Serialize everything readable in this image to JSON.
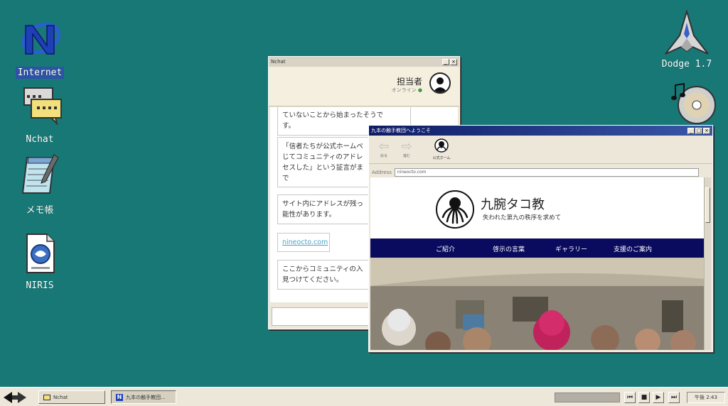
{
  "desktop": {
    "left_icons": [
      {
        "label": "Internet",
        "icon": "n-logo-icon",
        "selected": true
      },
      {
        "label": "Nchat",
        "icon": "chat-bubbles-icon"
      },
      {
        "label": "メモ帳",
        "icon": "notepad-icon"
      },
      {
        "label": "NIRIS",
        "icon": "document-icon"
      }
    ],
    "right_icons": [
      {
        "label": "Dodge 1.7",
        "icon": "spaceship-icon"
      },
      {
        "label": "",
        "icon": "music-cd-icon"
      }
    ]
  },
  "nchat": {
    "title": "Nchat",
    "agent_name": "担当者",
    "agent_status": "オンライン",
    "messages": [
      {
        "lines": [
          "ていないことから始まったそうで",
          "す。"
        ]
      },
      {
        "lines": [
          "「信者たちが公式ホームペ",
          "じてコミュニティのアドレ",
          "セスした」という証言がま",
          "で"
        ]
      },
      {
        "lines": [
          "サイト内にアドレスが残っ",
          "能性があります。"
        ]
      },
      {
        "lines": [
          "nineocto.com"
        ],
        "is_link": true
      },
      {
        "lines": [
          "ここからコミュニティの入",
          "見つけてください。"
        ]
      }
    ]
  },
  "browser": {
    "title": "九本の触手教団へようこそ",
    "toolbar": {
      "back": "戻る",
      "forward": "進む",
      "home": "公式ホーム"
    },
    "address_label": "Address",
    "address": "nineocto.com",
    "site": {
      "title": "九腕タコ教",
      "subtitle": "失われた第九の秩序を求めて",
      "nav": [
        "ご紹介",
        "啓示の言葉",
        "ギャラリー",
        "支援のご案内"
      ]
    }
  },
  "taskbar": {
    "buttons": [
      {
        "label": "Nchat"
      },
      {
        "label": "九本の触手教団..."
      }
    ],
    "clock": "午後 2:43",
    "progress": 0
  },
  "colors": {
    "desktop": "#177876",
    "title_active": "#0e1c66",
    "nav_bg": "#0a0a5e",
    "window_bg": "#ece7d9"
  }
}
